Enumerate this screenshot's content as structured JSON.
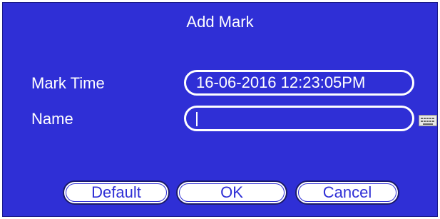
{
  "dialog": {
    "title": "Add Mark",
    "mark_time": {
      "label": "Mark Time",
      "value": "16-06-2016 12:23:05PM"
    },
    "name": {
      "label": "Name",
      "value": ""
    },
    "keyboard_icon": "keyboard-icon",
    "buttons": {
      "default": "Default",
      "ok": "OK",
      "cancel": "Cancel"
    },
    "colors": {
      "background": "#2f2fd6",
      "text": "#ffffff"
    }
  }
}
